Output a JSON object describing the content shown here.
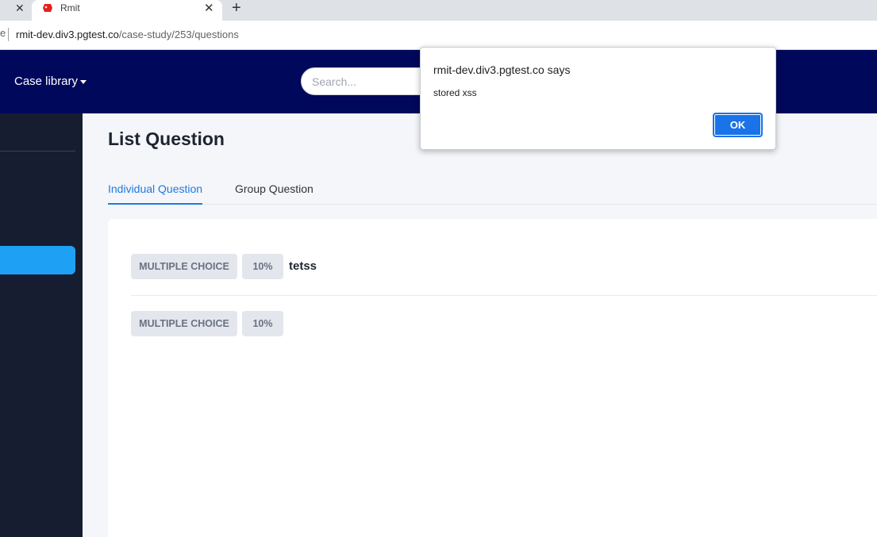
{
  "browser": {
    "tab_title": "Rmit",
    "address_left": "e",
    "url_host": "rmit-dev.div3.pgtest.co",
    "url_path": "/case-study/253/questions"
  },
  "header": {
    "case_library": "Case library",
    "search_placeholder": "Search..."
  },
  "page": {
    "title": "List Question",
    "tabs": [
      {
        "label": "Individual Question",
        "active": true
      },
      {
        "label": "Group Question",
        "active": false
      }
    ]
  },
  "questions": [
    {
      "type": "MULTIPLE CHOICE",
      "weight": "10%",
      "text": "tetss"
    },
    {
      "type": "MULTIPLE CHOICE",
      "weight": "10%",
      "text": ""
    }
  ],
  "dialog": {
    "title": "rmit-dev.div3.pgtest.co says",
    "message": "stored xss",
    "ok_label": "OK"
  },
  "colors": {
    "header_bg": "#00085b",
    "sidebar_bg": "#161d31",
    "sidebar_active": "#1ea0f5",
    "tab_active": "#1f7ae0",
    "ok_button": "#1a73e8"
  }
}
